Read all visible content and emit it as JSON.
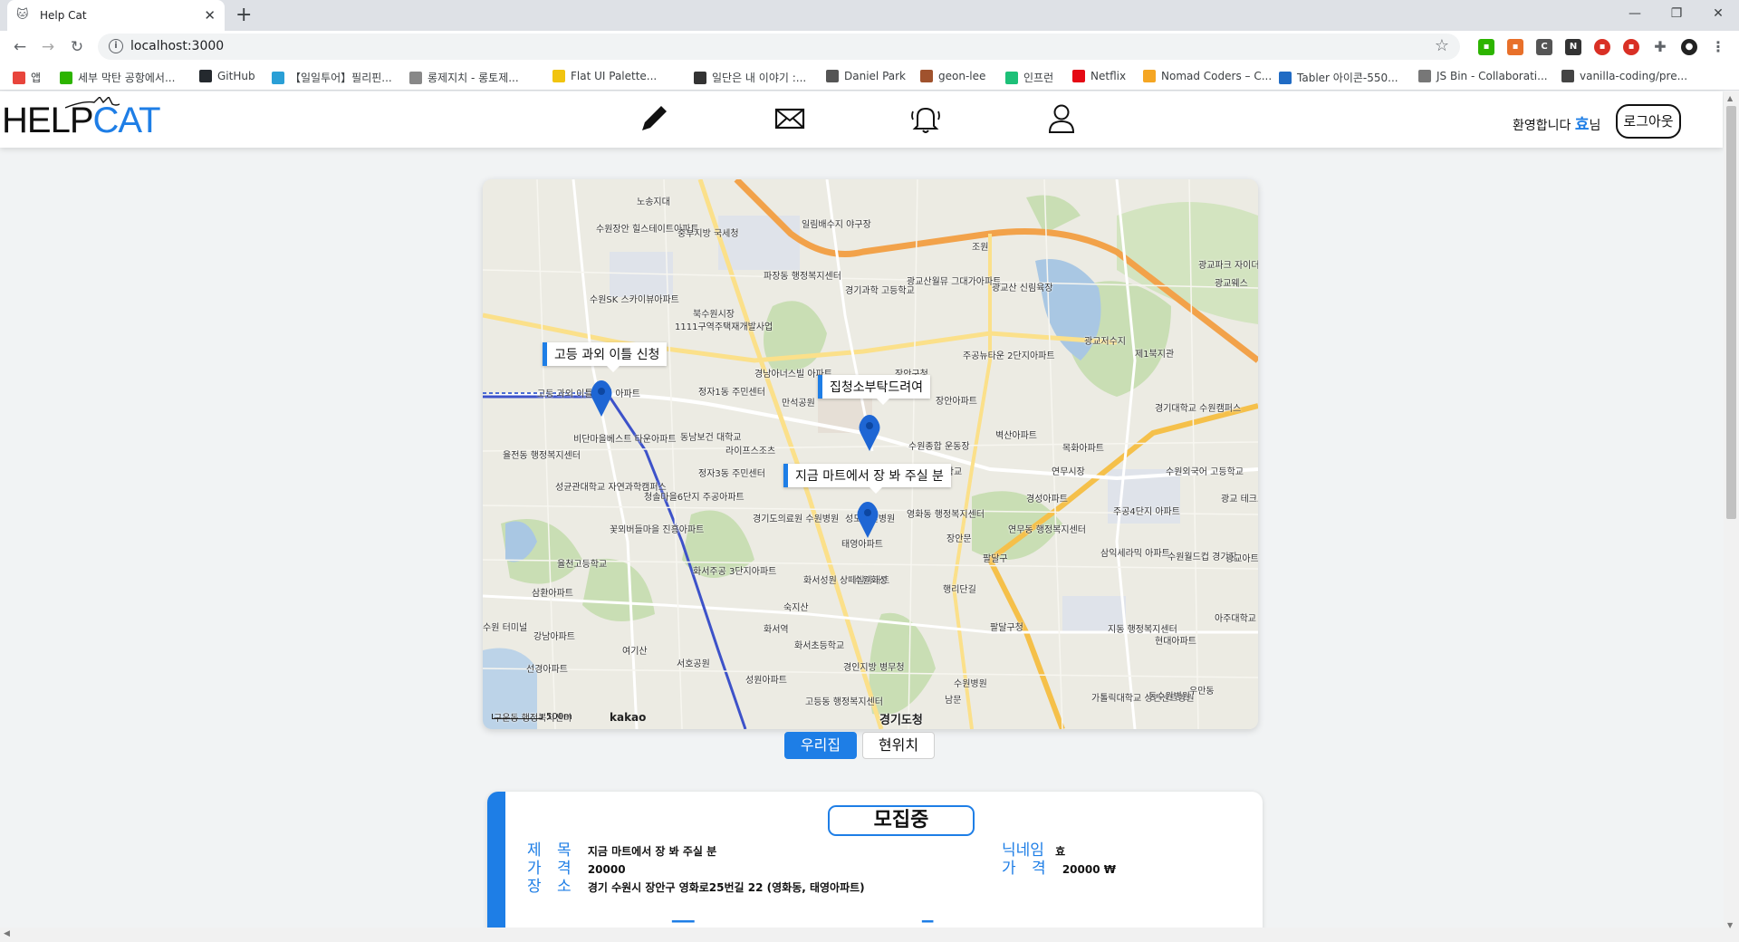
{
  "browser": {
    "tab_title": "Help Cat",
    "url": "localhost:3000",
    "bookmarks": [
      {
        "label": "앱",
        "color": "#e8453c"
      },
      {
        "label": "세부 막탄 공항에서...",
        "color": "#2db400"
      },
      {
        "label": "GitHub",
        "color": "#24292e"
      },
      {
        "label": "【일일투어】필리핀...",
        "color": "#2a9fd6"
      },
      {
        "label": "롱제지치 - 롱토제...",
        "color": "#888888"
      },
      {
        "label": "Flat UI Palette...",
        "color": "#f1c40f"
      },
      {
        "label": "일단은 내 이야기 :...",
        "color": "#333333"
      },
      {
        "label": "Daniel Park",
        "color": "#555555"
      },
      {
        "label": "geon-lee",
        "color": "#a0522d"
      },
      {
        "label": "인프런",
        "color": "#1dc078"
      },
      {
        "label": "Netflix",
        "color": "#e50914"
      },
      {
        "label": "Nomad Coders – C...",
        "color": "#f5a623"
      },
      {
        "label": "Tabler 아이콘-550...",
        "color": "#206bc4"
      },
      {
        "label": "JS Bin - Collaborati...",
        "color": "#777777"
      },
      {
        "label": "vanilla-coding/pre...",
        "color": "#444444"
      }
    ]
  },
  "header": {
    "logo_part1": "HELP",
    "logo_part2": "CAT",
    "nav_icons": [
      "pencil-icon",
      "mail-icon",
      "bell-icon",
      "user-icon"
    ],
    "welcome_text": "환영합니다",
    "nickname": "효",
    "honorific": "님",
    "logout_label": "로그아웃"
  },
  "map": {
    "info_windows": [
      {
        "text": "고등 과외 이틀 신청"
      },
      {
        "text": "집청소부탁드려여"
      },
      {
        "text": "지금 마트에서 장 봐 주실 분"
      }
    ],
    "place_labels": [
      "노송지대",
      "수원장안 힐스테이트아파트",
      "중부지방 국세청",
      "일림배수지 야구장",
      "파장동 행정복지센터",
      "경기과학 고등학교",
      "광교산월뮤 그대가아파트",
      "광교산 신림육장",
      "조원",
      "광교파크 자이더테라스",
      "광교웨스",
      "수원SK 스카이뷰아파트",
      "북수원시장",
      "1111구역주택재개발사업",
      "장안구청",
      "주공뉴타운 2단지아파트",
      "광교저수지",
      "제1북지관",
      "고등 과외 이틀 신청 아파트",
      "경남아너스빌 아파트",
      "정자1동 주민센터",
      "만석공원",
      "장안아파트",
      "경기대학교 수원캠퍼스",
      "비단마을베스트 타운아파트",
      "동남보건 대학교",
      "라이프스조츠",
      "수원종합 운동장",
      "벽산아파트",
      "율전동 행정복지센터",
      "성균관대학교 자연과학캠퍼스",
      "정자3동 주민센터",
      "영화초등학교",
      "연무시장",
      "목화아파트",
      "수원외국어 고등학교",
      "청솔마을6단지 주공아파트",
      "경기도의료원 수원병원",
      "성모학원병원",
      "태영아파트",
      "영화동 행정복지센터",
      "경성아파트",
      "주공4단지 아파트",
      "광교 테크노밸",
      "꽃뫼버들마을 진흥아파트",
      "연무동 행정복지센터",
      "수원월드컵 경기장",
      "장안문",
      "삼익세라믹 아파트",
      "율천고등학교",
      "화서주공 3단지아파트",
      "화서성원 상떼빌아파트",
      "수원화성",
      "팔달구",
      "행리단길",
      "삼환아파트",
      "숙지산",
      "광교아트데 아파트",
      "아주대학교",
      "강남아파트",
      "화서역",
      "여기산",
      "화서초등학교",
      "경인지방 병무청",
      "팔달구청",
      "지동 행정복지센터",
      "현대아파트",
      "선경아파트",
      "서호공원",
      "성원아파트",
      "수원병원",
      "가톨릭대학교 성빈센트병원",
      "동수원병원",
      "구운동 행정복지센터",
      "고등동 행정복지센터",
      "경기도청",
      "남문",
      "수원 터미널",
      "우만동"
    ],
    "scale_label": "500m",
    "brand": "kakao"
  },
  "map_buttons": {
    "home_label": "우리집",
    "current_label": "현위치"
  },
  "card": {
    "status_label": "모집중",
    "title_key": "제 목",
    "title_value": "지금 마트에서 장 봐 주실 분",
    "price_key": "가 격",
    "price_value": "20000",
    "place_key": "장 소",
    "place_value": "경기 수원시 장안구 영화로25번길 22 (영화동, 태영아파트)",
    "nickname_key": "닉네임",
    "nickname_value": "효",
    "price2_key": "가 격",
    "price2_value": "20000 ₩"
  },
  "colors": {
    "accent": "#1e7ee6",
    "background": "#f1f3f4"
  }
}
